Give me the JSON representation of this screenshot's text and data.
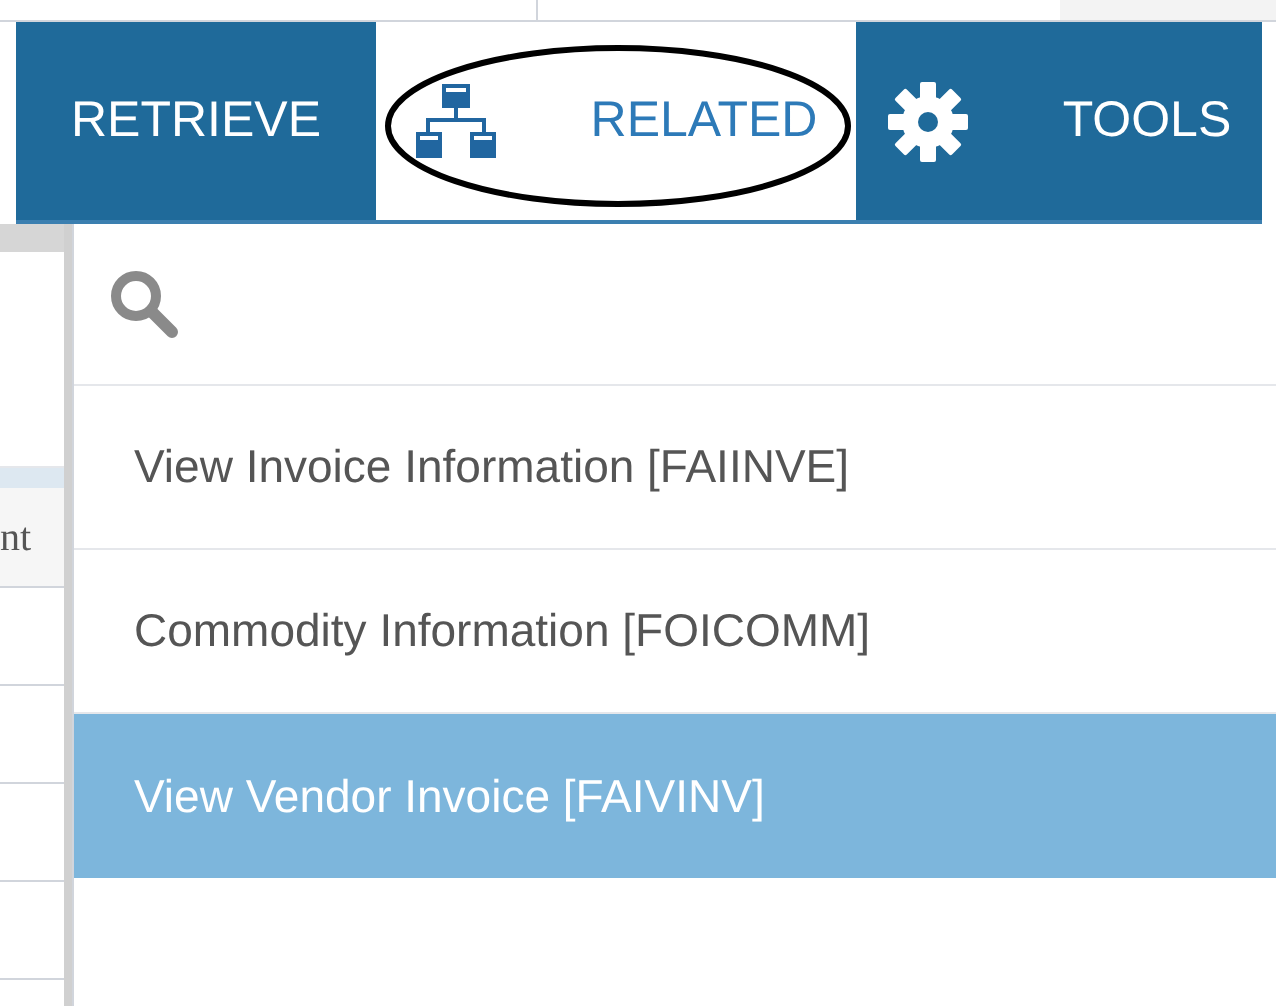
{
  "toolbar": {
    "tabs": [
      {
        "label": "RETRIEVE",
        "selected": false
      },
      {
        "label": "RELATED",
        "selected": true
      },
      {
        "label": "TOOLS",
        "selected": false
      }
    ]
  },
  "background_table": {
    "column_heading": "nt"
  },
  "related_menu": {
    "items": [
      {
        "label": "View Invoice Information [FAIINVE]",
        "selected": false
      },
      {
        "label": "Commodity Information [FOICOMM]",
        "selected": false
      },
      {
        "label": "View Vendor Invoice [FAIVINV]",
        "selected": true
      }
    ]
  }
}
